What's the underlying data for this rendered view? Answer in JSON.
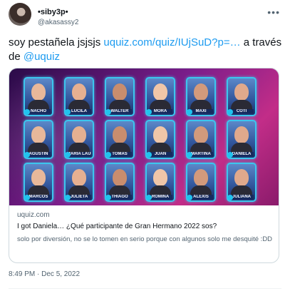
{
  "tweet": {
    "display_name": "•siby3p•",
    "handle": "@akasassy2",
    "more_icon": "more-horizontal-icon",
    "text_part1": "soy pestañela jsjsjs ",
    "link_text": "uquiz.com/quiz/IUjSuD?p=…",
    "text_part2": " a través de ",
    "mention": "@uquiz",
    "timestamp": "8:49 PM · Dec 5, 2022"
  },
  "card": {
    "domain": "uquiz.com",
    "title": "I got Daniela… ¿Qué participante de Gran Hermano 2022 sos?",
    "description": "solo por diversión, no se lo tomen en serio porque con algunos solo me desquité :DD",
    "contestants": [
      "NACHO",
      "LUCILA",
      "WALTER",
      "MORA",
      "MAXI",
      "COTI",
      "AGUSTÍN",
      "MARIA LAURA",
      "TOMÁS",
      "JUAN",
      "MARTINA",
      "DANIELA",
      "MARCOS",
      "JULIETA",
      "THIAGO",
      "ROMINA",
      "ALEXIS",
      "JULIANA"
    ]
  },
  "colors": {
    "link": "#1d9bf0",
    "card_border": "#cfd9de",
    "frame": "#3cc6ee"
  }
}
